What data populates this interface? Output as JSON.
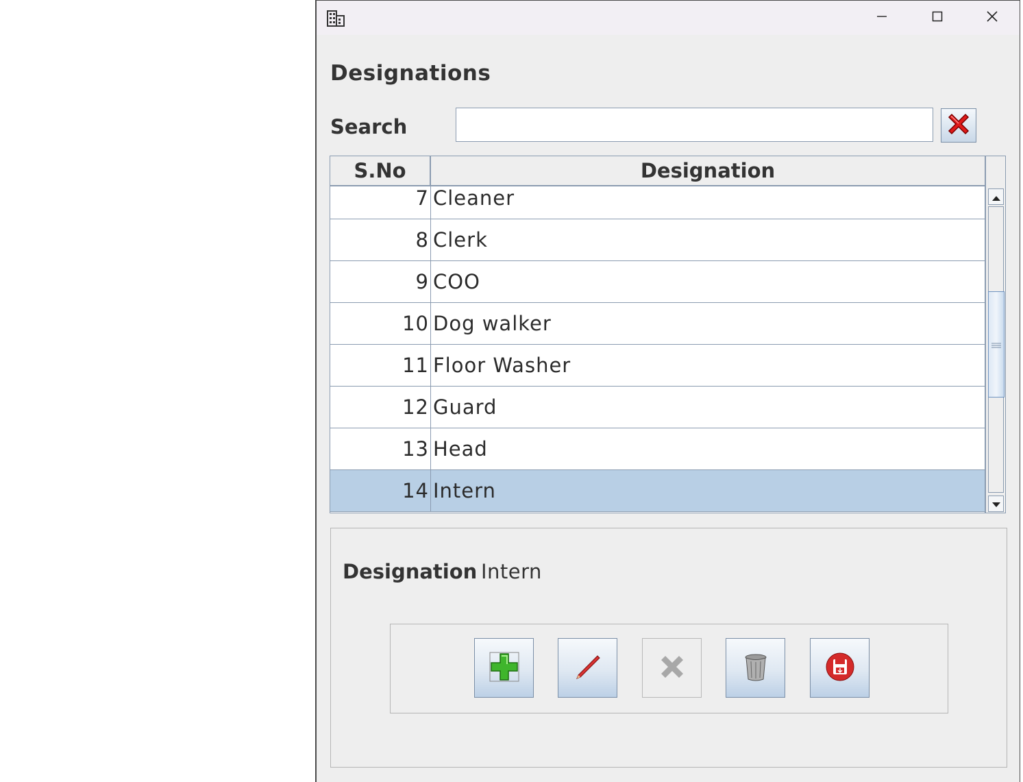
{
  "window": {
    "icon": "building-icon",
    "controls": {
      "minimize": "minimize-icon",
      "maximize": "maximize-icon",
      "close": "close-icon"
    }
  },
  "page": {
    "title": "Designations"
  },
  "search": {
    "label": "Search",
    "value": "",
    "clear_icon": "red-x-icon"
  },
  "table": {
    "columns": [
      "S.No",
      "Designation"
    ],
    "rows": [
      {
        "sno": "7",
        "designation": "Cleaner"
      },
      {
        "sno": "8",
        "designation": "Clerk"
      },
      {
        "sno": "9",
        "designation": "COO"
      },
      {
        "sno": "10",
        "designation": "Dog walker"
      },
      {
        "sno": "11",
        "designation": "Floor Washer"
      },
      {
        "sno": "12",
        "designation": "Guard"
      },
      {
        "sno": "13",
        "designation": "Head"
      },
      {
        "sno": "14",
        "designation": "Intern"
      }
    ],
    "selected_sno": "14",
    "selected_color": "#b8cfe5"
  },
  "detail": {
    "label": "Designation",
    "value": "Intern"
  },
  "actions": {
    "add_icon": "add-plus-icon",
    "edit_icon": "pencil-icon",
    "cancel_icon": "grey-x-icon",
    "delete_icon": "trash-icon",
    "save_icon": "save-disk-icon",
    "cancel_enabled": false
  }
}
